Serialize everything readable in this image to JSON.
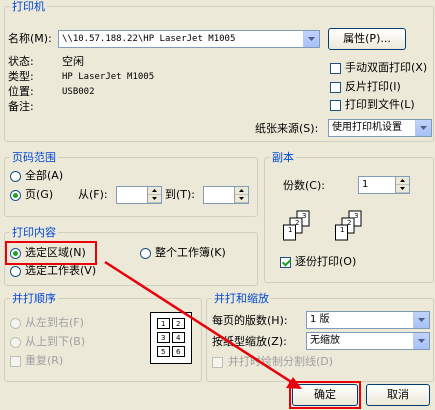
{
  "printer": {
    "group_title": "打印机",
    "name_label": "名称(M):",
    "name_value": "\\\\10.57.188.22\\HP LaserJet M1005",
    "properties_button": "属性(P)...",
    "status_label": "状态:",
    "status_value": "空闲",
    "type_label": "类型:",
    "type_value": "HP LaserJet M1005",
    "location_label": "位置:",
    "location_value": "USB002",
    "comment_label": "备注:",
    "manual_duplex": "手动双面打印(X)",
    "reverse_print": "反片打印(I)",
    "print_to_file": "打印到文件(L)",
    "paper_source_label": "纸张来源(S):",
    "paper_source_value": "使用打印机设置"
  },
  "page_range": {
    "title": "页码范围",
    "all": "全部(A)",
    "pages": "页(G)",
    "from_label": "从(F):",
    "to_label": "到(T):"
  },
  "copies": {
    "title": "副本",
    "count_label": "份数(C):",
    "count_value": "1",
    "collate": "逐份打印(O)",
    "collate_checked": true,
    "page_icon_labels": [
      "3",
      "2",
      "1",
      "3",
      "2",
      "1"
    ]
  },
  "print_what": {
    "title": "打印内容",
    "selection": "选定区域(N)",
    "entire_workbook": "整个工作簿(K)",
    "active_sheets": "选定工作表(V)",
    "selected": "selection"
  },
  "print_order": {
    "title": "并打顺序",
    "left_to_right": "从左到右(F)",
    "top_to_bottom": "从上到下(B)",
    "repeat": "重复(R)",
    "layout_digits": [
      "1",
      "2",
      "3",
      "4",
      "5",
      "6"
    ]
  },
  "zoom": {
    "title": "并打和缩放",
    "pages_per_sheet_label": "每页的版数(H):",
    "pages_per_sheet_value": "1 版",
    "scale_label": "按纸型缩放(Z):",
    "scale_value": "无缩放",
    "draw_borders": "并打时绘制分割线(D)"
  },
  "buttons": {
    "ok": "确定",
    "cancel": "取消"
  },
  "colors": {
    "highlight": "#e8000b",
    "legend": "#0046d5",
    "dialog_bg": "#ece9d8"
  }
}
